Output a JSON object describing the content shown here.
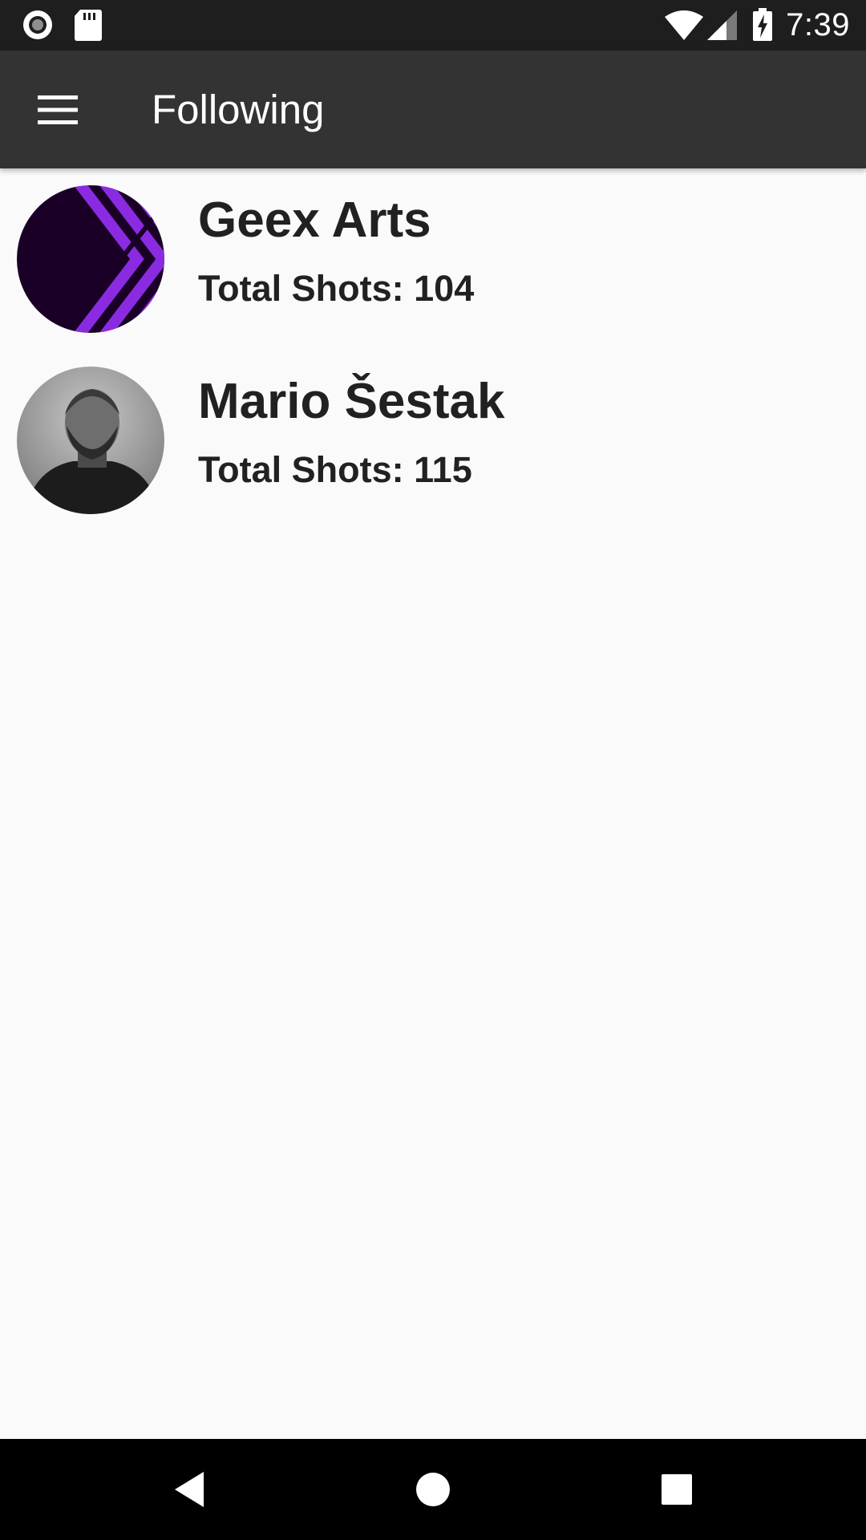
{
  "status_bar": {
    "time": "7:39",
    "left_icons": [
      "record-icon",
      "sd-card-icon"
    ],
    "right_icons": [
      "wifi-icon",
      "cell-signal-icon",
      "battery-charging-icon"
    ]
  },
  "app_bar": {
    "title": "Following",
    "menu_icon": "hamburger-menu-icon",
    "background": "#333333"
  },
  "following": [
    {
      "name": "Geex Arts",
      "shots": "Total Shots: 104",
      "avatar_icon": "geex-arts-logo-avatar",
      "accent": "#8a2be2"
    },
    {
      "name": "Mario Šestak",
      "shots": "Total Shots: 115",
      "avatar_icon": "profile-photo-avatar"
    }
  ],
  "nav_bar": {
    "buttons": [
      "back-icon",
      "home-icon",
      "recents-icon"
    ]
  }
}
